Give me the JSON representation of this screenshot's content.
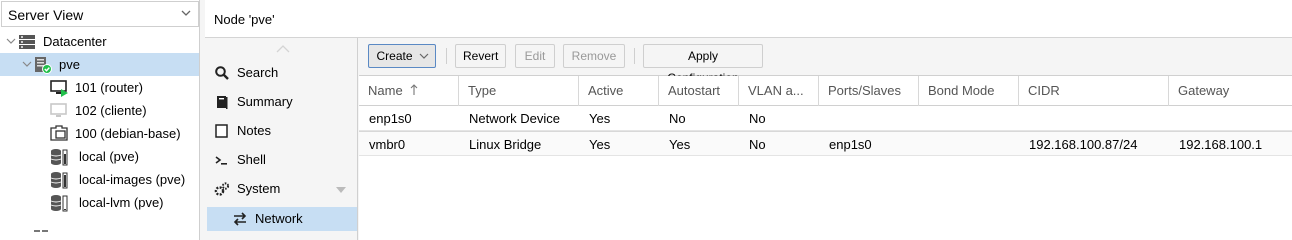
{
  "view_selector": {
    "label": "Server View"
  },
  "tree": {
    "datacenter": "Datacenter",
    "node": "pve",
    "guests": [
      {
        "label": "101 (router)"
      },
      {
        "label": "102 (cliente)"
      },
      {
        "label": "100 (debian-base)"
      }
    ],
    "storages": [
      {
        "label": "local (pve)"
      },
      {
        "label": "local-images (pve)"
      },
      {
        "label": "local-lvm (pve)"
      }
    ]
  },
  "header": {
    "title": "Node 'pve'"
  },
  "nav": {
    "items": [
      {
        "label": "Search"
      },
      {
        "label": "Summary"
      },
      {
        "label": "Notes"
      },
      {
        "label": "Shell"
      },
      {
        "label": "System"
      }
    ],
    "sub_items": [
      {
        "label": "Network"
      }
    ]
  },
  "toolbar": {
    "create": "Create",
    "revert": "Revert",
    "edit": "Edit",
    "remove": "Remove",
    "apply": "Apply Configuration"
  },
  "table": {
    "columns": [
      "Name",
      "Type",
      "Active",
      "Autostart",
      "VLAN a...",
      "Ports/Slaves",
      "Bond Mode",
      "CIDR",
      "Gateway"
    ],
    "rows": [
      [
        "enp1s0",
        "Network Device",
        "Yes",
        "No",
        "No",
        "",
        "",
        "",
        ""
      ],
      [
        "vmbr0",
        "Linux Bridge",
        "Yes",
        "Yes",
        "No",
        "enp1s0",
        "",
        "192.168.100.87/24",
        "192.168.100.1"
      ]
    ]
  },
  "colors": {
    "selection": "#c7def3",
    "accent": "#5a89c4",
    "status_ok": "#21bf4b",
    "vm_running": "#21bf4b"
  }
}
